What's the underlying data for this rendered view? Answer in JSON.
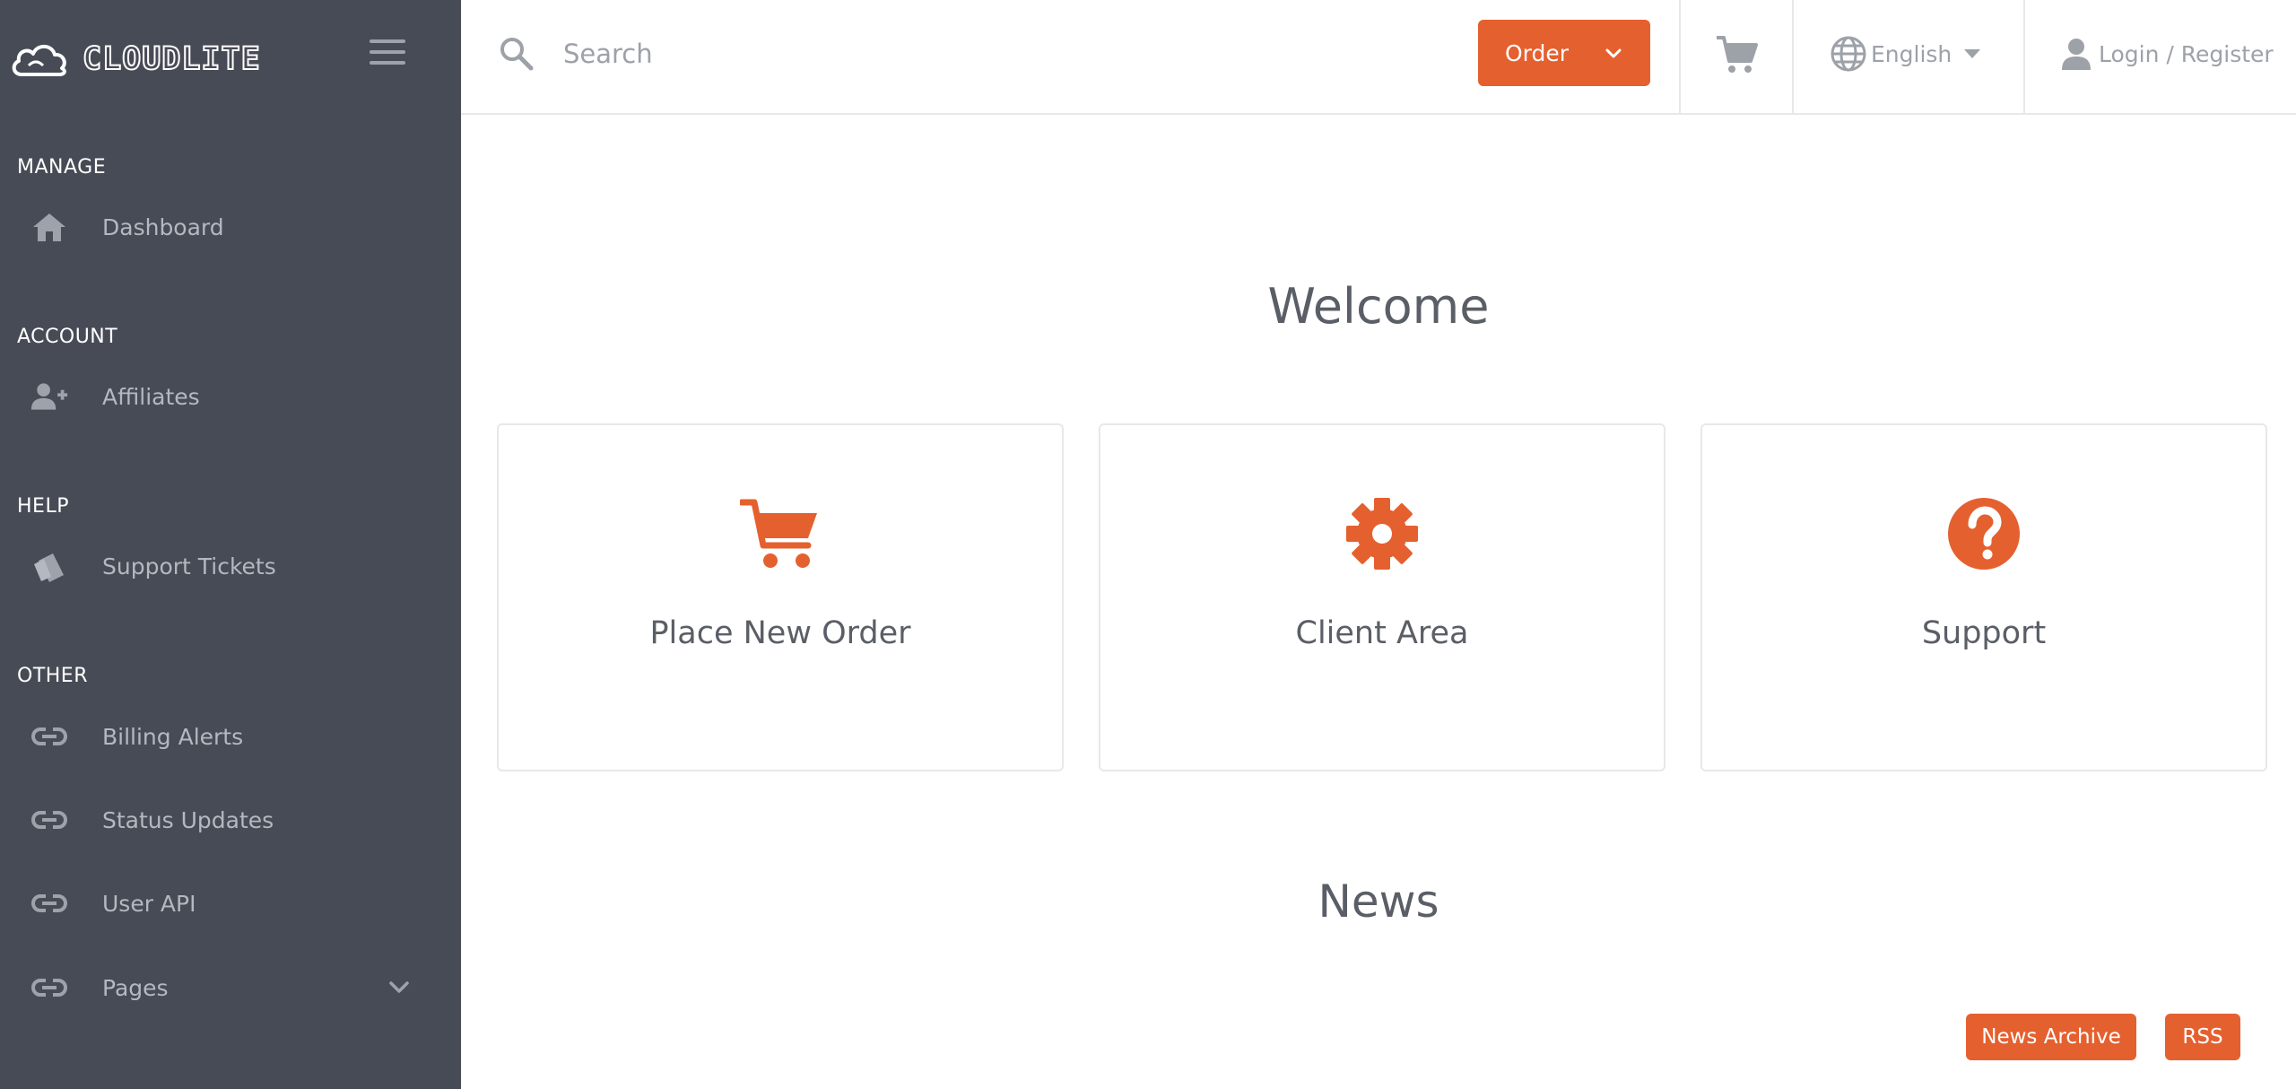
{
  "brand": {
    "name": "CLOUDLITE"
  },
  "sidebar": {
    "sections": [
      {
        "label": "MANAGE",
        "items": [
          {
            "label": "Dashboard",
            "icon": "home-icon"
          }
        ]
      },
      {
        "label": "ACCOUNT",
        "items": [
          {
            "label": "Affiliates",
            "icon": "user-plus-icon"
          }
        ]
      },
      {
        "label": "HELP",
        "items": [
          {
            "label": "Support Tickets",
            "icon": "ticket-icon"
          }
        ]
      },
      {
        "label": "OTHER",
        "items": [
          {
            "label": "Billing Alerts",
            "icon": "link-icon"
          },
          {
            "label": "Status Updates",
            "icon": "link-icon"
          },
          {
            "label": "User API",
            "icon": "link-icon"
          },
          {
            "label": "Pages",
            "icon": "link-icon",
            "expandable": true
          }
        ]
      }
    ]
  },
  "header": {
    "search_placeholder": "Search",
    "order_label": "Order",
    "language": "English",
    "login_label": "Login / Register"
  },
  "main": {
    "welcome_title": "Welcome",
    "cards": [
      {
        "label": "Place New Order",
        "icon": "cart-icon"
      },
      {
        "label": "Client Area",
        "icon": "gear-icon"
      },
      {
        "label": "Support",
        "icon": "question-circle-icon"
      }
    ],
    "news_title": "News",
    "news_archive_label": "News Archive",
    "rss_label": "RSS"
  },
  "colors": {
    "sidebar_bg": "#474b55",
    "accent": "#e5602f",
    "text": "#5a5e66",
    "muted": "#9da1a8"
  }
}
